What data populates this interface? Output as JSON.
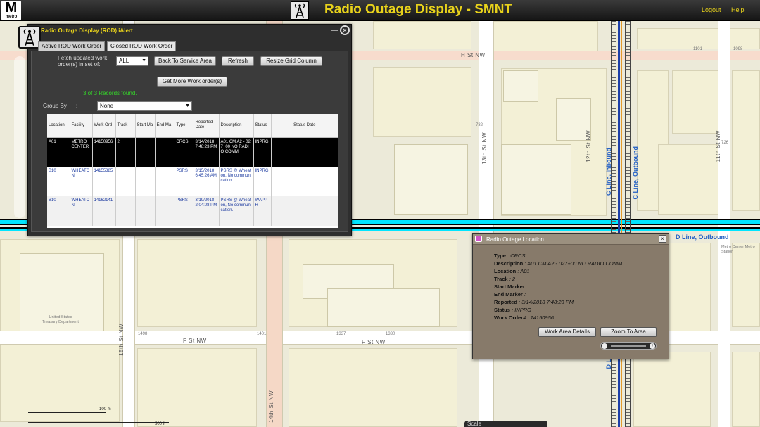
{
  "header": {
    "logo_letter": "M",
    "logo_text": "metro",
    "title": "Radio Outage Display - SMNT",
    "logout": "Logout",
    "help": "Help"
  },
  "rod_window": {
    "title": "Radio Outage Display (ROD) iAlert",
    "minimize": "—",
    "close": "×",
    "tabs": [
      "Active ROD Work Order",
      "Closed ROD Work Order"
    ],
    "fetch_label": "Fetch updated work order(s) in set of:",
    "fetch_value": "ALL",
    "back_button": "Back To Service Area",
    "refresh_button": "Refresh",
    "resize_button": "Resize Grid Column",
    "more_button": "Get More Work order(s)",
    "records_found": "3 of 3 Records found.",
    "group_by_label": "Group By",
    "group_by_sep": ":",
    "group_by_value": "None",
    "columns": [
      "Location",
      "Facility",
      "Work Ord",
      "Track",
      "Start Ma",
      "End Ma",
      "Type",
      "Reported Date",
      "Description",
      "Status",
      "Status Date"
    ],
    "rows": [
      [
        "A01",
        "METRO CENTER",
        "14150956",
        "2",
        "",
        "",
        "CRCS",
        "3/14/2018 7:48:23 PM",
        "A01 CM A2 - 027+00 NO RADIO COMM",
        "INPRG",
        ""
      ],
      [
        "B10",
        "WHEATON",
        "14155385",
        "",
        "",
        "",
        "PSRS",
        "3/15/2018 6:45:26 AM",
        "PSRS @ Wheaton, No communication.",
        "INPRG",
        ""
      ],
      [
        "B10",
        "WHEATON",
        "14162141",
        "",
        "",
        "",
        "PSRS",
        "3/19/2018 2:04:08 PM",
        "PSRS @ Wheaton, No communication.",
        "WAPPR",
        ""
      ]
    ]
  },
  "popup": {
    "title": "Radio Outage Location",
    "close": "×",
    "fields": [
      {
        "label": "Type",
        "value": "CRCS"
      },
      {
        "label": "Description",
        "value": "A01 CM A2 - 027+00 NO RADIO COMM"
      },
      {
        "label": "Location",
        "value": "A01"
      },
      {
        "label": "Track",
        "value": "2"
      },
      {
        "label": "Start Marker",
        "value": ""
      },
      {
        "label": "End Marker",
        "value": ""
      },
      {
        "label": "Reported",
        "value": "3/14/2018 7:48:23 PM"
      },
      {
        "label": "Status",
        "value": "INPRG"
      },
      {
        "label": "Work Order#",
        "value": "14150956"
      }
    ],
    "work_area_button": "Work Area Details",
    "zoom_button": "Zoom To Area"
  },
  "map": {
    "streets": {
      "h_st": "H St NW",
      "f_st": "F St NW",
      "f_st2": "F St NW",
      "13th": "13th St NW",
      "12th": "12th St NW",
      "11th": "11th St NW",
      "15th": "15th St NW",
      "14th": "14th St NW"
    },
    "lines": {
      "c_in": "C Line, Inbound",
      "c_out": "C Line, Outbound",
      "d_out": "D Line, Outbound",
      "d_l": "D L"
    },
    "places": {
      "metro_center": "Metro Center Metro Station",
      "treasury": "United States Treasury Department"
    },
    "numbers": [
      "1101",
      "1098",
      "732",
      "726",
      "1401",
      "1337",
      "1498",
      "1330"
    ],
    "scale": {
      "m": "100 m",
      "ft": "500 ft",
      "tab": "Scale"
    }
  }
}
